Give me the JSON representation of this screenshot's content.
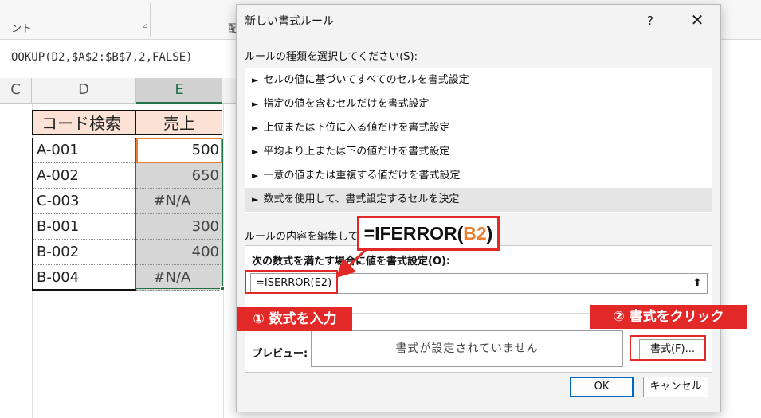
{
  "ribbon": {
    "label_fragment": "ント",
    "cut_label": "配"
  },
  "formula_bar": {
    "text": "OOKUP(D2,$A$2:$B$7,2,FALSE)"
  },
  "sheet": {
    "column_headers": [
      "C",
      "D",
      "E"
    ],
    "table_headers": [
      "コード検索",
      "売上"
    ],
    "rows": [
      {
        "code": "A-001",
        "sales": "500"
      },
      {
        "code": "A-002",
        "sales": "650"
      },
      {
        "code": "C-003",
        "sales": "#N/A"
      },
      {
        "code": "B-001",
        "sales": "300"
      },
      {
        "code": "B-002",
        "sales": "400"
      },
      {
        "code": "B-004",
        "sales": "#N/A"
      }
    ]
  },
  "dialog": {
    "title": "新しい書式ルール",
    "help_label": "?",
    "close_label": "✕",
    "rule_type_label": "ルールの種類を選択してください(S):",
    "rule_types": [
      "セルの値に基づいてすべてのセルを書式設定",
      "指定の値を含むセルだけを書式設定",
      "上位または下位に入る値だけを書式設定",
      "平均より上または下の値だけを書式設定",
      "一意の値または重複する値だけを書式設定",
      "数式を使用して、書式設定するセルを決定"
    ],
    "rule_bullet": "►",
    "edit_label": "ルールの内容を編集してく",
    "condition_label": "次の数式を満たす場合に値を書式設定(O):",
    "formula_value": "=ISERROR(E2)",
    "collapse_icon": "⬆",
    "preview_label": "プレビュー:",
    "preview_text": "書式が設定されていません",
    "format_button": "書式(F)...",
    "ok_button": "OK",
    "cancel_button": "キャンセル"
  },
  "annotations": {
    "callout_prefix": "=IFERROR(",
    "callout_accent": "B2",
    "callout_suffix": ")",
    "step1": "① 数式を入力",
    "step2": "② 書式をクリック",
    "accent_color": "#e32828",
    "highlight_color": "#ed7d31"
  }
}
